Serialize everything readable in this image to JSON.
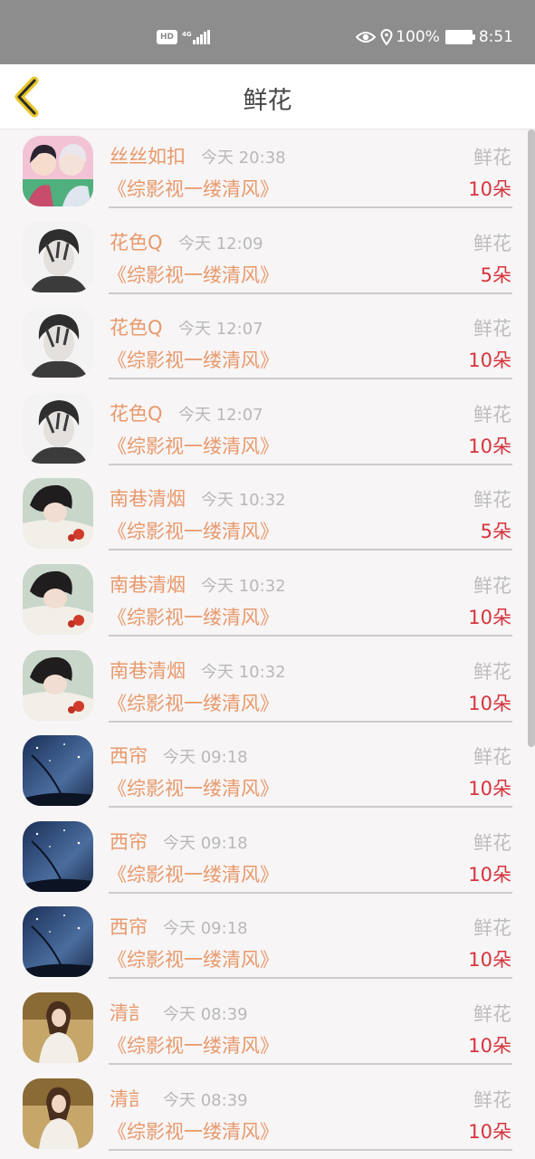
{
  "status_bar": {
    "hd": "HD",
    "network": "4G",
    "battery": "100%",
    "clock": "8:51",
    "icons": [
      "eye-icon",
      "location-icon",
      "battery-charging-icon",
      "signal-icon"
    ]
  },
  "header": {
    "title": "鲜花",
    "back_icon": "chevron-left-icon",
    "accent_color": "#e8c62a"
  },
  "colors": {
    "name": "#e8996b",
    "time": "#b9b9b9",
    "count": "#d6343c"
  },
  "rows": [
    {
      "name": "丝丝如扣",
      "time": "今天 20:38",
      "type": "鲜花",
      "book": "《综影视一缕清风》",
      "count": "10朵",
      "avatar": "anime-couple"
    },
    {
      "name": "花色Q",
      "time": "今天 12:09",
      "type": "鲜花",
      "book": "《综影视一缕清风》",
      "count": "5朵",
      "avatar": "boy-sketch"
    },
    {
      "name": "花色Q",
      "time": "今天 12:07",
      "type": "鲜花",
      "book": "《综影视一缕清风》",
      "count": "10朵",
      "avatar": "boy-sketch"
    },
    {
      "name": "花色Q",
      "time": "今天 12:07",
      "type": "鲜花",
      "book": "《综影视一缕清风》",
      "count": "10朵",
      "avatar": "boy-sketch"
    },
    {
      "name": "南巷清烟",
      "time": "今天 10:32",
      "type": "鲜花",
      "book": "《综影视一缕清风》",
      "count": "5朵",
      "avatar": "lying-girl"
    },
    {
      "name": "南巷清烟",
      "time": "今天 10:32",
      "type": "鲜花",
      "book": "《综影视一缕清风》",
      "count": "10朵",
      "avatar": "lying-girl"
    },
    {
      "name": "南巷清烟",
      "time": "今天 10:32",
      "type": "鲜花",
      "book": "《综影视一缕清风》",
      "count": "10朵",
      "avatar": "lying-girl"
    },
    {
      "name": "西帘",
      "time": "今天 09:18",
      "type": "鲜花",
      "book": "《综影视一缕清风》",
      "count": "10朵",
      "avatar": "night-sky"
    },
    {
      "name": "西帘",
      "time": "今天 09:18",
      "type": "鲜花",
      "book": "《综影视一缕清风》",
      "count": "10朵",
      "avatar": "night-sky"
    },
    {
      "name": "西帘",
      "time": "今天 09:18",
      "type": "鲜花",
      "book": "《综影视一缕清风》",
      "count": "10朵",
      "avatar": "night-sky"
    },
    {
      "name": "清訁",
      "time": "今天 08:39",
      "type": "鲜花",
      "book": "《综影视一缕清风》",
      "count": "10朵",
      "avatar": "garden-girl"
    },
    {
      "name": "清訁",
      "time": "今天 08:39",
      "type": "鲜花",
      "book": "《综影视一缕清风》",
      "count": "10朵",
      "avatar": "garden-girl"
    }
  ]
}
